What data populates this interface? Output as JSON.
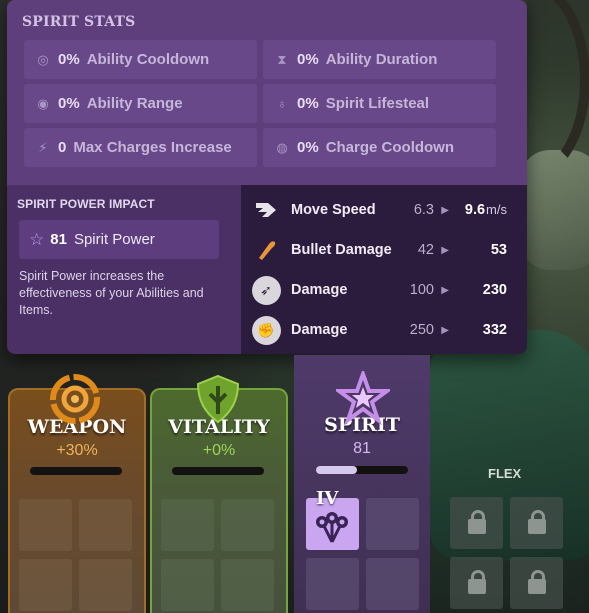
{
  "spirit_stats": {
    "title": "SPIRIT STATS",
    "stats": [
      {
        "value": "0%",
        "label": "Ability Cooldown",
        "icon": "cooldown-icon"
      },
      {
        "value": "0%",
        "label": "Ability Duration",
        "icon": "hourglass-icon"
      },
      {
        "value": "0%",
        "label": "Ability Range",
        "icon": "range-icon"
      },
      {
        "value": "0%",
        "label": "Spirit Lifesteal",
        "icon": "lifesteal-icon"
      },
      {
        "value": "0",
        "label": "Max Charges Increase",
        "icon": "charges-icon"
      },
      {
        "value": "0%",
        "label": "Charge Cooldown",
        "icon": "charge-cooldown-icon"
      }
    ]
  },
  "impact": {
    "title": "SPIRIT POWER IMPACT",
    "power_value": "81",
    "power_label": "Spirit Power",
    "description": "Spirit Power increases the effectiveness of your Abilities and Items.",
    "rows": [
      {
        "name": "Move Speed",
        "from": "6.3",
        "to": "9.6",
        "unit": "m/s",
        "icon": "move-speed-icon"
      },
      {
        "name": "Bullet Damage",
        "from": "42",
        "to": "53",
        "icon": "bullet-icon"
      },
      {
        "name": "Damage",
        "from": "100",
        "to": "230",
        "icon": "ability-bow-icon"
      },
      {
        "name": "Damage",
        "from": "250",
        "to": "332",
        "icon": "ability-strike-icon"
      }
    ]
  },
  "categories": {
    "weapon": {
      "title": "WEAPON",
      "value": "+30%",
      "color": "#f0b45a"
    },
    "vitality": {
      "title": "VITALITY",
      "value": "+0%",
      "color": "#9fd456"
    },
    "spirit": {
      "title": "SPIRIT",
      "value": "81",
      "color": "#d4b8f2",
      "bar_progress": 0.45
    },
    "flex": {
      "title": "FLEX"
    }
  },
  "spirit_item": {
    "tier": "IV"
  }
}
